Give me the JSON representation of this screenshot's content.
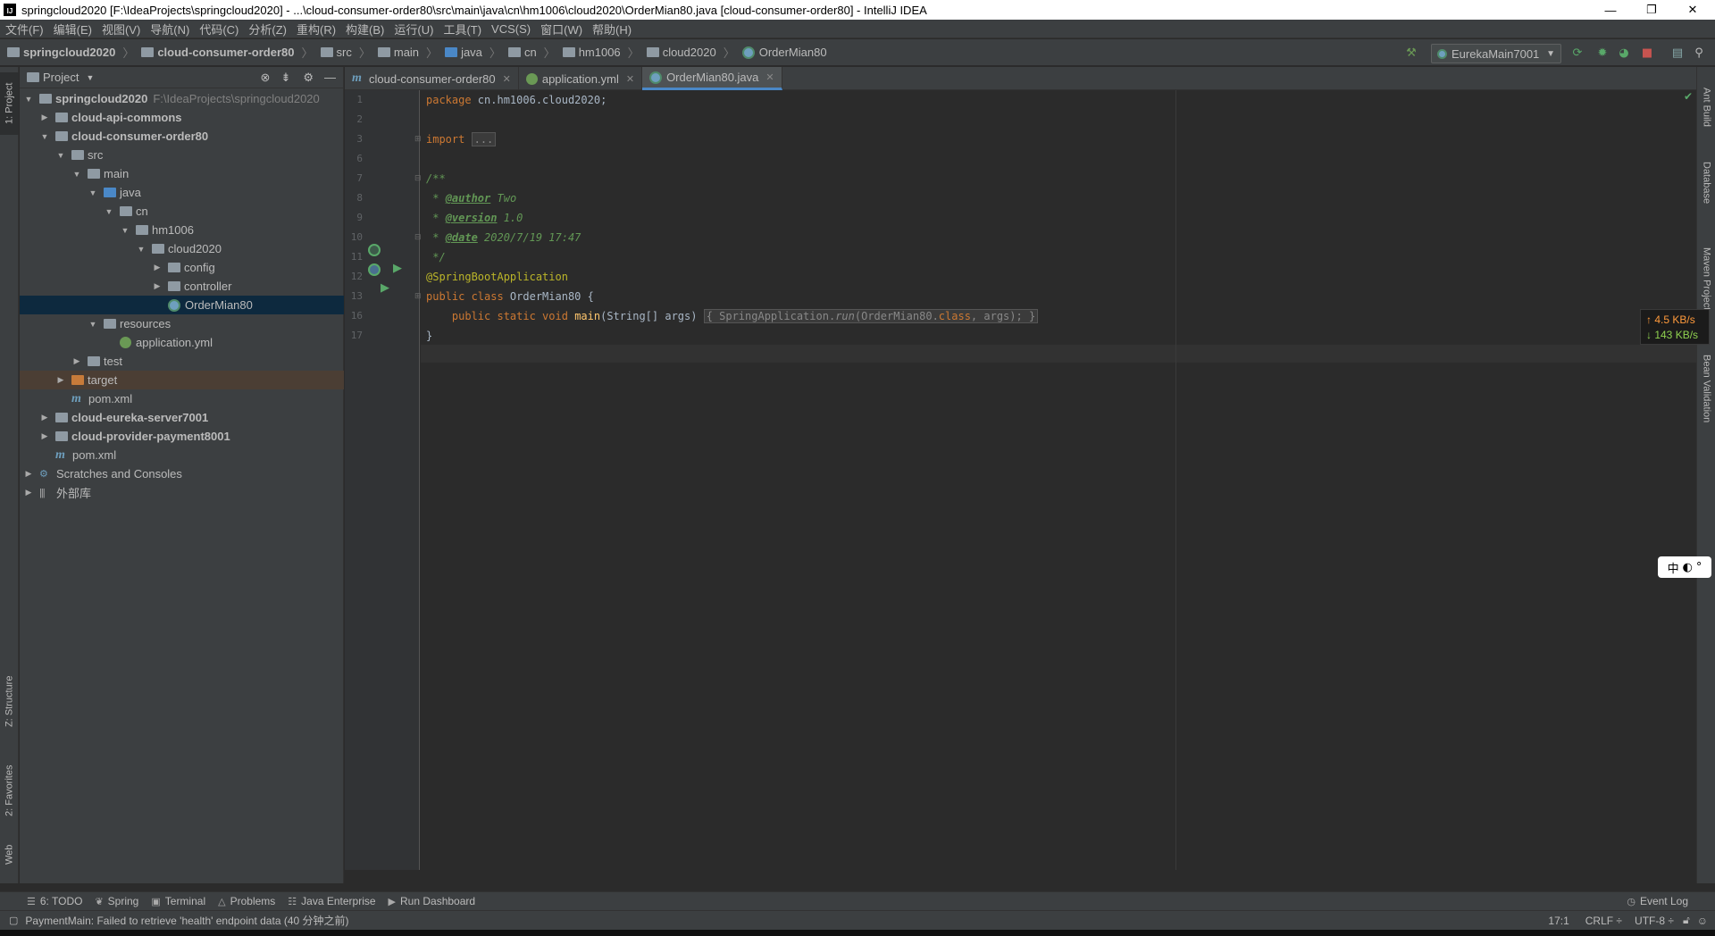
{
  "window": {
    "title": "springcloud2020 [F:\\IdeaProjects\\springcloud2020] - ...\\cloud-consumer-order80\\src\\main\\java\\cn\\hm1006\\cloud2020\\OrderMian80.java [cloud-consumer-order80] - IntelliJ IDEA",
    "logo_text": "IJ",
    "controls": [
      "—",
      "❐",
      "✕"
    ]
  },
  "menu": [
    "文件(F)",
    "编辑(E)",
    "视图(V)",
    "导航(N)",
    "代码(C)",
    "分析(Z)",
    "重构(R)",
    "构建(B)",
    "运行(U)",
    "工具(T)",
    "VCS(S)",
    "窗口(W)",
    "帮助(H)"
  ],
  "breadcrumb": [
    "springcloud2020",
    "cloud-consumer-order80",
    "src",
    "main",
    "java",
    "cn",
    "hm1006",
    "cloud2020",
    "OrderMian80"
  ],
  "run_config": {
    "label": "EurekaMain7001"
  },
  "left_tabs": {
    "project": "1: Project",
    "structure": "Z: Structure",
    "favorites": "2: Favorites",
    "web": "Web"
  },
  "right_tabs": {
    "ant": "Ant Build",
    "database": "Database",
    "maven": "Maven Projects",
    "bean": "Bean Validation"
  },
  "project_panel": {
    "title": "Project",
    "tree": [
      {
        "label": "springcloud2020",
        "path": "F:\\IdeaProjects\\springcloud2020",
        "indent": 0,
        "arrow": "▼",
        "icon": "folder",
        "bold": true
      },
      {
        "label": "cloud-api-commons",
        "indent": 1,
        "arrow": "▶",
        "icon": "folder",
        "bold": true
      },
      {
        "label": "cloud-consumer-order80",
        "indent": 1,
        "arrow": "▼",
        "icon": "folder",
        "bold": true
      },
      {
        "label": "src",
        "indent": 2,
        "arrow": "▼",
        "icon": "folder"
      },
      {
        "label": "main",
        "indent": 3,
        "arrow": "▼",
        "icon": "folder"
      },
      {
        "label": "java",
        "indent": 4,
        "arrow": "▼",
        "icon": "folder-blue"
      },
      {
        "label": "cn",
        "indent": 5,
        "arrow": "▼",
        "icon": "folder"
      },
      {
        "label": "hm1006",
        "indent": 6,
        "arrow": "▼",
        "icon": "folder"
      },
      {
        "label": "cloud2020",
        "indent": 7,
        "arrow": "▼",
        "icon": "folder"
      },
      {
        "label": "config",
        "indent": 8,
        "arrow": "▶",
        "icon": "folder"
      },
      {
        "label": "controller",
        "indent": 8,
        "arrow": "▶",
        "icon": "folder"
      },
      {
        "label": "OrderMian80",
        "indent": 8,
        "arrow": "",
        "icon": "java-class",
        "selected": true
      },
      {
        "label": "resources",
        "indent": 4,
        "arrow": "▼",
        "icon": "folder"
      },
      {
        "label": "application.yml",
        "indent": 5,
        "arrow": "",
        "icon": "yml"
      },
      {
        "label": "test",
        "indent": 3,
        "arrow": "▶",
        "icon": "folder"
      },
      {
        "label": "target",
        "indent": 2,
        "arrow": "▶",
        "icon": "folder-orange",
        "excluded": true
      },
      {
        "label": "pom.xml",
        "indent": 2,
        "arrow": "",
        "icon": "maven"
      },
      {
        "label": "cloud-eureka-server7001",
        "indent": 1,
        "arrow": "▶",
        "icon": "folder",
        "bold": true
      },
      {
        "label": "cloud-provider-payment8001",
        "indent": 1,
        "arrow": "▶",
        "icon": "folder",
        "bold": true
      },
      {
        "label": "pom.xml",
        "indent": 1,
        "arrow": "",
        "icon": "maven"
      },
      {
        "label": "Scratches and Consoles",
        "indent": 0,
        "arrow": "▶",
        "icon": "scratch"
      },
      {
        "label": "外部库",
        "indent": 0,
        "arrow": "▶",
        "icon": "library"
      }
    ]
  },
  "editor_tabs": [
    {
      "label": "cloud-consumer-order80",
      "icon": "maven"
    },
    {
      "label": "application.yml",
      "icon": "yml"
    },
    {
      "label": "OrderMian80.java",
      "icon": "java-class",
      "active": true
    }
  ],
  "code": {
    "line_numbers": [
      "1",
      "2",
      "3",
      "6",
      "7",
      "8",
      "9",
      "10",
      "11",
      "12",
      "13",
      "16",
      "17"
    ],
    "line1_kw": "package",
    "line1_rest": " cn.hm1006.cloud2020;",
    "line3_kw": "import",
    "line3_fold": "...",
    "line6": "/**",
    "line7_star": " * ",
    "line7_tag": "@author",
    "line7_val": " Two",
    "line8_star": " * ",
    "line8_tag": "@version",
    "line8_val": " 1.0",
    "line9_star": " * ",
    "line9_tag": "@date",
    "line9_val": " 2020/7/19 17:47",
    "line10": " */",
    "line11": "@SpringBootApplication",
    "line12_kw": "public class",
    "line12_rest": " OrderMian80 {",
    "line13_indent": "    ",
    "line13_kw": "public static void",
    "line13_sp": " ",
    "line13_fn": "main",
    "line13_args": "(String[] args) ",
    "line13_fold_a": "{ SpringApplication.",
    "line13_fold_run": "run",
    "line13_fold_b": "(OrderMian80.",
    "line13_fold_cls": "class",
    "line13_fold_c": ", args); }",
    "line16": "}"
  },
  "net_speed": {
    "up": "↑ 4.5 KB/s",
    "down": "↓ 143 KB/s"
  },
  "ime": {
    "lang": "中"
  },
  "bottom_tools": [
    {
      "label": "6: TODO",
      "icon": "☰"
    },
    {
      "label": "Spring",
      "icon": "❦"
    },
    {
      "label": "Terminal",
      "icon": "▣"
    },
    {
      "label": "Problems",
      "icon": "△"
    },
    {
      "label": "Java Enterprise",
      "icon": "☷"
    },
    {
      "label": "Run Dashboard",
      "icon": "▶"
    }
  ],
  "event_log": "Event Log",
  "status": {
    "message": "PaymentMain: Failed to retrieve 'health' endpoint data (40 分钟之前)",
    "position": "17:1",
    "line_sep": "CRLF ÷",
    "encoding": "UTF-8 ÷"
  },
  "colors": {
    "accent": "#4a88c7",
    "selection": "#0d293e",
    "keyword": "#cc7832",
    "comment": "#629755",
    "annotation": "#bbb529",
    "function": "#ffc66d"
  }
}
